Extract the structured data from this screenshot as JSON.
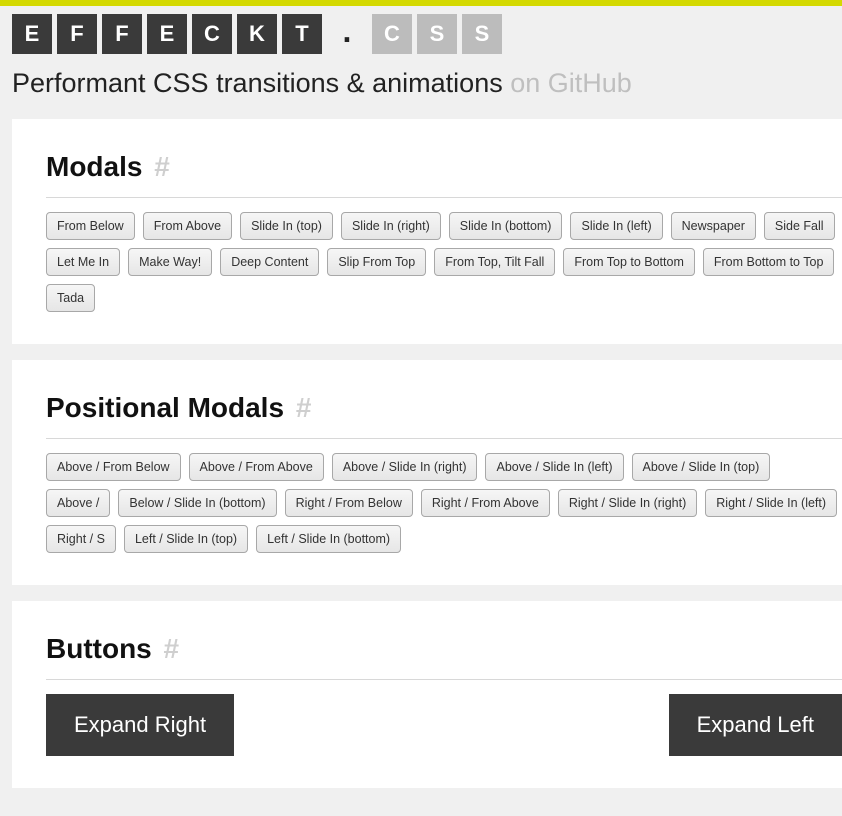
{
  "logo": {
    "tiles": [
      {
        "char": "E",
        "style": "dark"
      },
      {
        "char": "F",
        "style": "dark"
      },
      {
        "char": "F",
        "style": "dark"
      },
      {
        "char": "E",
        "style": "dark"
      },
      {
        "char": "C",
        "style": "dark"
      },
      {
        "char": "K",
        "style": "dark"
      },
      {
        "char": "T",
        "style": "dark"
      },
      {
        "char": ".",
        "style": "dot"
      },
      {
        "char": "C",
        "style": "light"
      },
      {
        "char": "S",
        "style": "light"
      },
      {
        "char": "S",
        "style": "light"
      }
    ]
  },
  "subtitle": {
    "main": "Performant CSS transitions & animations ",
    "link": "on GitHub"
  },
  "sections": {
    "modals": {
      "title": "Modals",
      "hash": "#",
      "buttons": [
        "From Below",
        "From Above",
        "Slide In (top)",
        "Slide In (right)",
        "Slide In (bottom)",
        "Slide In (left)",
        "Newspaper",
        "Side Fall",
        "Let Me In",
        "Make Way!",
        "Deep Content",
        "Slip From Top",
        "From Top, Tilt Fall",
        "From Top to Bottom",
        "From Bottom to Top",
        "Tada"
      ]
    },
    "positional_modals": {
      "title": "Positional Modals",
      "hash": "#",
      "buttons": [
        "Above / From Below",
        "Above / From Above",
        "Above / Slide In (right)",
        "Above / Slide In (left)",
        "Above / Slide In (top)",
        "Above /",
        "Below / Slide In (bottom)",
        "Right / From Below",
        "Right / From Above",
        "Right / Slide In (right)",
        "Right / Slide In (left)",
        "Right / S",
        "Left / Slide In (top)",
        "Left / Slide In (bottom)"
      ]
    },
    "buttons_demo": {
      "title": "Buttons",
      "hash": "#",
      "big_buttons": [
        "Expand Right",
        "Expand Left"
      ]
    }
  }
}
